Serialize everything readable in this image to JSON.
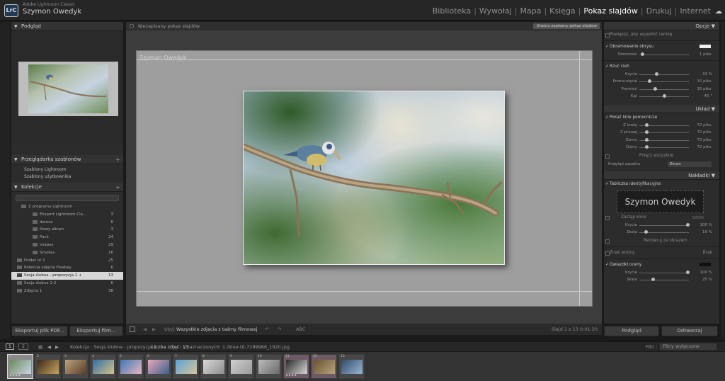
{
  "app": {
    "logo_text": "LrC",
    "app_name": "Adobe Lightroom Classic",
    "user_name": "Szymon Owedyk"
  },
  "modules": [
    "Biblioteka",
    "Wywołaj",
    "Mapa",
    "Księga",
    "Pokaz slajdów",
    "Drukuj",
    "Internet"
  ],
  "active_module": "Pokaz slajdów",
  "left": {
    "preview_header": "Podgląd",
    "templates_header": "Przeglądarka szablonów",
    "templates": [
      "Szablony Lightroom",
      "Szablony użytkownika"
    ],
    "collections_header": "Kolekcje",
    "collections": [
      {
        "name": "Z programu Lightroom",
        "count": ""
      },
      {
        "name": "Eksport Lightroom Cla...",
        "count": "3"
      },
      {
        "name": "demov",
        "count": "6"
      },
      {
        "name": "Nowy album",
        "count": "3"
      },
      {
        "name": "Pack",
        "count": "24"
      },
      {
        "name": "shapes",
        "count": "29"
      },
      {
        "name": "Smokes",
        "count": "16"
      },
      {
        "name": "Folder nr 1",
        "count": "25"
      },
      {
        "name": "Kolekcja zdjęcia Pixabay",
        "count": "6"
      },
      {
        "name": "Sesja ślubna - propozycja 1 +",
        "count": "13"
      },
      {
        "name": "Sesja ślubna 1-2",
        "count": "6"
      },
      {
        "name": "Zdjęcia 1",
        "count": "38"
      }
    ],
    "export_pdf": "Eksportuj plik PDF...",
    "export_film": "Eksportuj film..."
  },
  "center": {
    "unsaved_label": "Niezapisany pokaz slajdów",
    "save_button": "Utwórz zapisany pokaz slajdów",
    "identity_plate": "Szymon Owedyk",
    "use_label": "Użyj:",
    "use_value": "Wszystkie zdjęcia z taśmy filmowej",
    "abc": "ABC",
    "slide_counter": "Slajd 1 z 13  0:01:20"
  },
  "right": {
    "options_header": "Opcje",
    "zoom_to_fill": "Powiększ, aby wypełnić ramkę",
    "stroke_border": "Obramowanie obrysu",
    "stroke_width_label": "Szerokość",
    "stroke_width_value": "1 piks.",
    "cast_shadow": "Rzuć cień",
    "shadow": [
      {
        "label": "Krycie",
        "value": "33 %",
        "pos": 0.33
      },
      {
        "label": "Przesunięcie",
        "value": "15 piks.",
        "pos": 0.18
      },
      {
        "label": "Promień",
        "value": "30 piks.",
        "pos": 0.3
      },
      {
        "label": "Kąt",
        "value": "- 45 °",
        "pos": 0.5
      }
    ],
    "layout_header": "Układ",
    "show_guides": "Pokaż linie pomocnicze",
    "guides": [
      {
        "label": "Z lewej",
        "value": "72 piks.",
        "pos": 0.12
      },
      {
        "label": "Z prawej",
        "value": "72 piks.",
        "pos": 0.12
      },
      {
        "label": "Górny",
        "value": "72 piks.",
        "pos": 0.12
      },
      {
        "label": "Dolny",
        "value": "72 piks.",
        "pos": 0.12
      }
    ],
    "link_all": "Połącz wszystkie",
    "aspect_label": "Podgląd aspektu",
    "aspect_value": "Ekran",
    "overlays_header": "Nakładki",
    "identity_plate_label": "Tabliczka identyfikacyjna",
    "plate_text": "Szymon Owedyk",
    "override_color": "Zastąp kolor",
    "plate_sliders": [
      {
        "label": "Krycie",
        "value": "100 %",
        "pos": 1.0
      },
      {
        "label": "Skala",
        "value": "10 %",
        "pos": 0.1
      }
    ],
    "render_behind": "Renderuj za obrazem",
    "watermark": "Znak wodny",
    "watermark_value": "Brak",
    "rating_stars": "Gwiazdki oceny",
    "star_sliders": [
      {
        "label": "Krycie",
        "value": "100 %",
        "pos": 1.0
      },
      {
        "label": "Skala",
        "value": "25 %",
        "pos": 0.25
      }
    ],
    "preview_button": "Podgląd",
    "play_button": "Odtwarzaj"
  },
  "status_bar": {
    "page1": "1",
    "page2": "2",
    "collection_path": "Kolekcja : Sesja ślubna - propozycja 1",
    "count_text": "Liczba zdjęć: 13",
    "selected_text": "/ zaznaczonych: 1 /blue-tit-7199966_1920.jpg",
    "filter_label": "Filtr :",
    "filter_value": "Filtry wyłączone"
  },
  "filmstrip": [
    {
      "n": "1",
      "stars": "★★★★",
      "c1": "#6c8a5b",
      "c2": "#c8d6e4"
    },
    {
      "n": "2",
      "stars": "",
      "c1": "#3a2a1c",
      "c2": "#c8a45c"
    },
    {
      "n": "3",
      "stars": "",
      "c1": "#bda27a",
      "c2": "#5a3d2a"
    },
    {
      "n": "4",
      "stars": "",
      "c1": "#2e6fa8",
      "c2": "#d8c28a"
    },
    {
      "n": "5",
      "stars": "",
      "c1": "#3e78b5",
      "c2": "#e7b5c2"
    },
    {
      "n": "6",
      "stars": "",
      "c1": "#e8a7bc",
      "c2": "#3d5f8a"
    },
    {
      "n": "7",
      "stars": "",
      "c1": "#5aa3d8",
      "c2": "#d7c49a"
    },
    {
      "n": "8",
      "stars": "",
      "c1": "#d9d9d9",
      "c2": "#8c8c8c"
    },
    {
      "n": "9",
      "stars": "",
      "c1": "#cfcfcf",
      "c2": "#9a9a9a"
    },
    {
      "n": "10",
      "stars": "",
      "c1": "#bcbcbc",
      "c2": "#6a6a6a"
    },
    {
      "n": "11",
      "stars": "★★★★",
      "c1": "#2a2a2a",
      "c2": "#d8d8d8"
    },
    {
      "n": "12",
      "stars": "",
      "c1": "#6a5232",
      "c2": "#b7a27c"
    },
    {
      "n": "13",
      "stars": "",
      "c1": "#304a6a",
      "c2": "#9ab5d1"
    }
  ]
}
